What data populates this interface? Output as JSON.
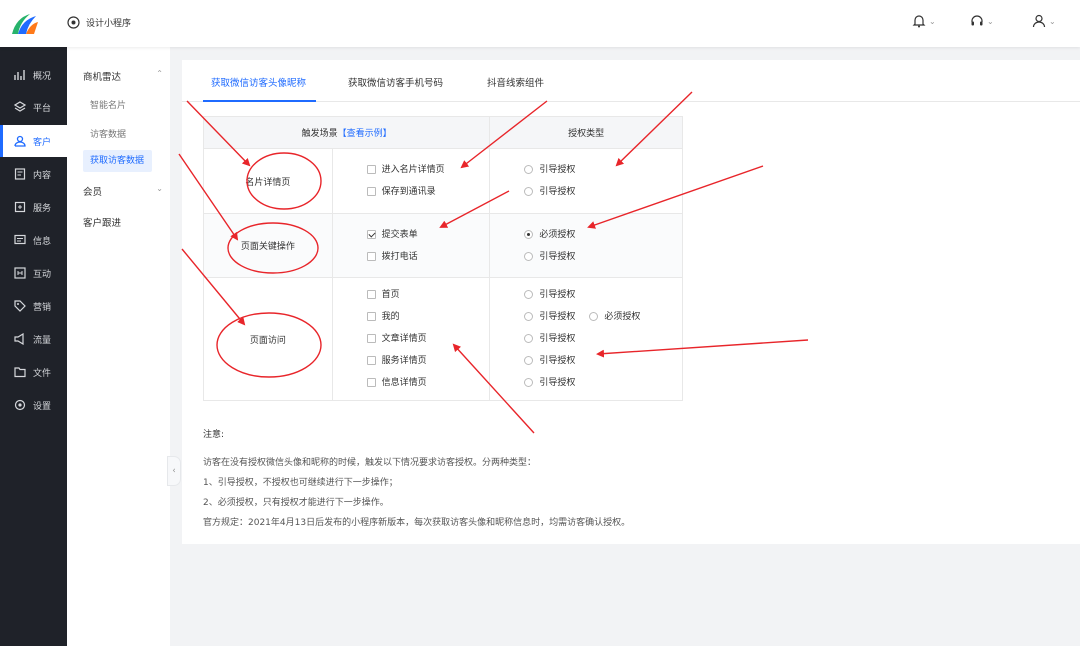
{
  "app": {
    "name": "设计小程序"
  },
  "nav": [
    {
      "label": "概况",
      "icon": "chart-icon"
    },
    {
      "label": "平台",
      "icon": "layers-icon"
    },
    {
      "label": "客户",
      "icon": "user-icon"
    },
    {
      "label": "内容",
      "icon": "document-icon"
    },
    {
      "label": "服务",
      "icon": "service-icon"
    },
    {
      "label": "信息",
      "icon": "message-icon"
    },
    {
      "label": "互动",
      "icon": "interaction-icon"
    },
    {
      "label": "营销",
      "icon": "tag-icon"
    },
    {
      "label": "流量",
      "icon": "megaphone-icon"
    },
    {
      "label": "文件",
      "icon": "folder-icon"
    },
    {
      "label": "设置",
      "icon": "settings-icon"
    }
  ],
  "subnav": {
    "section1": "商机雷达",
    "items": [
      "智能名片",
      "访客数据",
      "获取访客数据"
    ],
    "section2": "会员",
    "section3": "客户跟进"
  },
  "tabs": [
    "获取微信访客头像昵称",
    "获取微信访客手机号码",
    "抖音线索组件"
  ],
  "table": {
    "head_scene": "触发场景",
    "head_example": "【查看示例】",
    "head_auth": "授权类型",
    "rows": [
      {
        "scene": "名片详情页",
        "items": [
          {
            "label": "进入名片详情页",
            "checked": false,
            "auth": "引导授权"
          },
          {
            "label": "保存到通讯录",
            "checked": false,
            "auth": "引导授权"
          }
        ]
      },
      {
        "scene": "页面关键操作",
        "items": [
          {
            "label": "提交表单",
            "checked": true,
            "auth": "必须授权"
          },
          {
            "label": "拨打电话",
            "checked": false,
            "auth": "引导授权"
          }
        ]
      },
      {
        "scene": "页面访问",
        "items": [
          {
            "label": "首页",
            "checked": false,
            "auth": "引导授权"
          },
          {
            "label": "我的",
            "checked": false,
            "auth": "引导授权",
            "auth2": "必须授权"
          },
          {
            "label": "文章详情页",
            "checked": false,
            "auth": "引导授权"
          },
          {
            "label": "服务详情页",
            "checked": false,
            "auth": "引导授权"
          },
          {
            "label": "信息详情页",
            "checked": false,
            "auth": "引导授权"
          }
        ]
      }
    ]
  },
  "notes": {
    "title": "注意:",
    "lines": [
      "访客在没有授权微信头像和昵称的时候，触发以下情况要求访客授权。分两种类型：",
      "1、引导授权，不授权也可继续进行下一步操作；",
      "2、必须授权，只有授权才能进行下一步操作。",
      "官方规定：2021年4月13日后发布的小程序新版本，每次获取访客头像和昵称信息时，均需访客确认授权。"
    ]
  },
  "colors": {
    "accent": "#1f6bff",
    "nav_bg": "#1f2229",
    "annotation": "#e8252a"
  }
}
